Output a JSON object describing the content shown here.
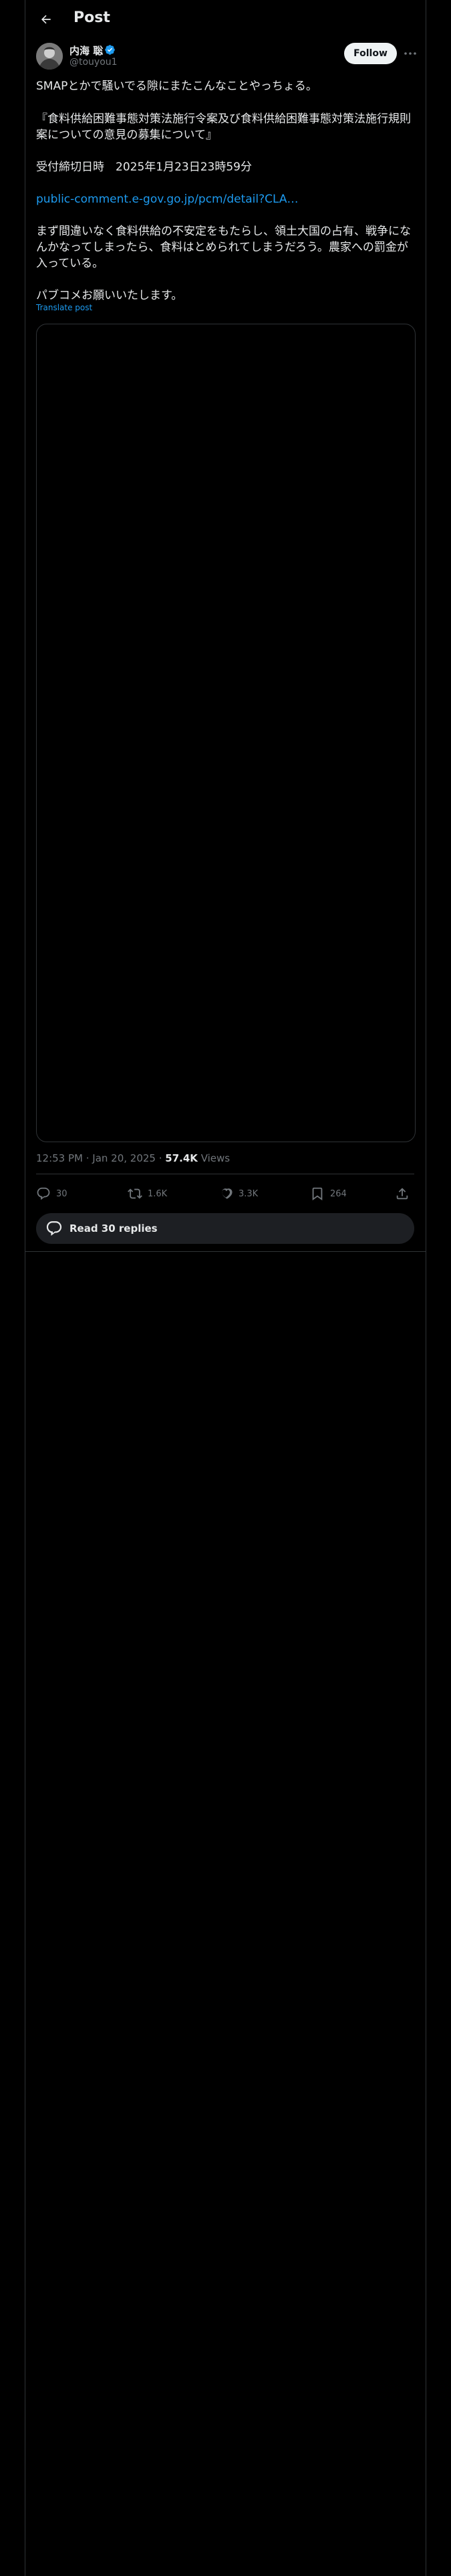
{
  "header": {
    "title": "Post",
    "back_icon": "arrow-left-icon"
  },
  "author": {
    "name": "内海 聡",
    "handle": "@touyou1",
    "verified": true
  },
  "follow_label": "Follow",
  "post": {
    "line1": "SMAPとかで騒いでる隙にまたこんなことやっちょる。",
    "line2": "『食料供給困難事態対策法施行令案及び食料供給困難事態対策法施行規則案についての意見の募集について』",
    "line3": "受付締切日時　2025年1月23日23時59分",
    "link": "public-comment.e-gov.go.jp/pcm/detail?CLA…",
    "line4": "まず間違いなく食料供給の不安定をもたらし、領土大国の占有、戦争になんかなってしまったら、食料はとめられてしまうだろう。農家への罰金が入っている。",
    "line5": "パブコメお願いいたします。",
    "translate": "Translate post"
  },
  "meta": {
    "time": "12:53 PM · Jan 20, 2025 · ",
    "views_count": "57.4K",
    "views_label": " Views"
  },
  "actions": {
    "replies": "30",
    "reposts": "1.6K",
    "likes": "3.3K",
    "bookmarks": "264"
  },
  "read_replies_label": "Read 30 replies",
  "colors": {
    "accent": "#1d9bf0",
    "background": "#000000",
    "text": "#e7e9ea",
    "muted": "#71767b",
    "follow_bg": "#eff3f4"
  }
}
